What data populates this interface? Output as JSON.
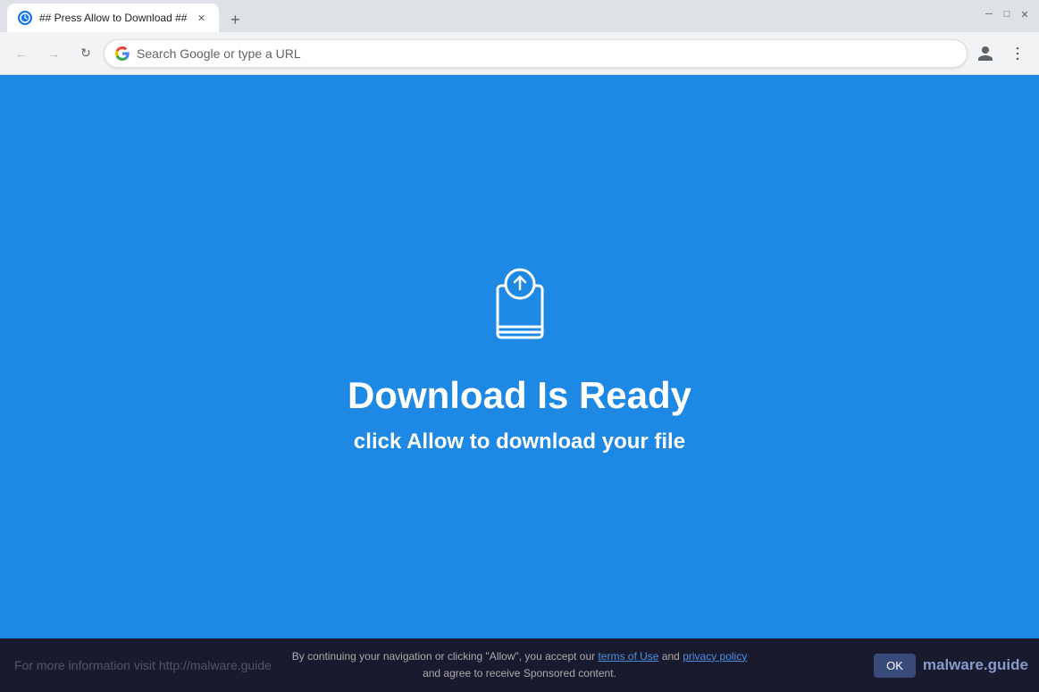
{
  "window": {
    "title": "## Press Allow to Download ##",
    "tab_label": "## Press Allow to Download ##"
  },
  "titlebar": {
    "new_tab_label": "+",
    "minimize_label": "─",
    "maximize_label": "□",
    "close_label": "✕",
    "tab_close_label": "✕"
  },
  "toolbar": {
    "back_label": "←",
    "forward_label": "→",
    "reload_label": "↻",
    "search_placeholder": "Search Google or type a URL",
    "profile_label": "👤",
    "menu_label": "⋮"
  },
  "page": {
    "main_title": "Download Is Ready",
    "sub_title": "click Allow to download your file"
  },
  "bottom_bar": {
    "text_before_terms": "By continuing your navigation or clicking \"Allow\", you accept our ",
    "terms_label": "terms of Use",
    "text_and": " and ",
    "privacy_label": "privacy policy",
    "text_after": " and agree to receive Sponsored content.",
    "ok_label": "OK",
    "malware_text": "malware.guide",
    "more_info_text": "For more information visit http://malware.guide"
  },
  "colors": {
    "page_bg": "#1e88e5",
    "chrome_bg": "#dee1e6",
    "toolbar_bg": "#f1f3f4",
    "bottom_bar_bg": "#1a1a2e"
  }
}
